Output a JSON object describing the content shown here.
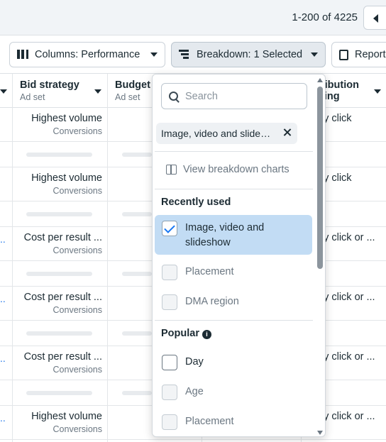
{
  "pager": {
    "range_text": "1-200 of 4225"
  },
  "toolbar": {
    "columns_label": "Columns: Performance",
    "breakdown_label": "Breakdown: 1 Selected",
    "reports_label": "Reports"
  },
  "table": {
    "headers": {
      "bid_strategy": {
        "title": "Bid strategy",
        "sub": "Ad set"
      },
      "budget": {
        "title": "Budget",
        "sub": "Ad set"
      },
      "attribution": {
        "title_line1": "ribution",
        "title_line2": "ting"
      }
    },
    "rows": [
      {
        "bid": "Highest volume",
        "bid_sub": "Conversions",
        "attr": "ay click",
        "dots": ""
      },
      {
        "bid": "Highest volume",
        "bid_sub": "Conversions",
        "attr": "ay click",
        "dots": ""
      },
      {
        "bid": "Cost per result ...",
        "bid_sub": "Conversions",
        "attr": "ay click or ...",
        "dots": ".."
      },
      {
        "bid": "Cost per result ...",
        "bid_sub": "Conversions",
        "attr": "ay click or ...",
        "dots": ".."
      },
      {
        "bid": "Cost per result ...",
        "bid_sub": "Conversions",
        "attr": "ay click or ...",
        "dots": ".."
      },
      {
        "bid": "Highest volume",
        "bid_sub": "Conversions",
        "attr": "ay click or ...",
        "dots": ".."
      }
    ]
  },
  "dropdown": {
    "search_placeholder": "Search",
    "selected_chip": "Image, video and slideshow",
    "view_charts_label": "View breakdown charts",
    "recently_used_title": "Recently used",
    "recently_used": [
      {
        "label": "Image, video and slideshow",
        "checked": true
      },
      {
        "label": "Placement",
        "checked": false
      },
      {
        "label": "DMA region",
        "checked": false
      }
    ],
    "popular_title": "Popular",
    "popular": [
      {
        "label": "Day",
        "checked": false
      },
      {
        "label": "Age",
        "checked": false
      },
      {
        "label": "Placement",
        "checked": false
      }
    ]
  },
  "colors": {
    "accent": "#1877f2",
    "selected_bg": "#c2dcf4",
    "text": "#1c2b33"
  }
}
